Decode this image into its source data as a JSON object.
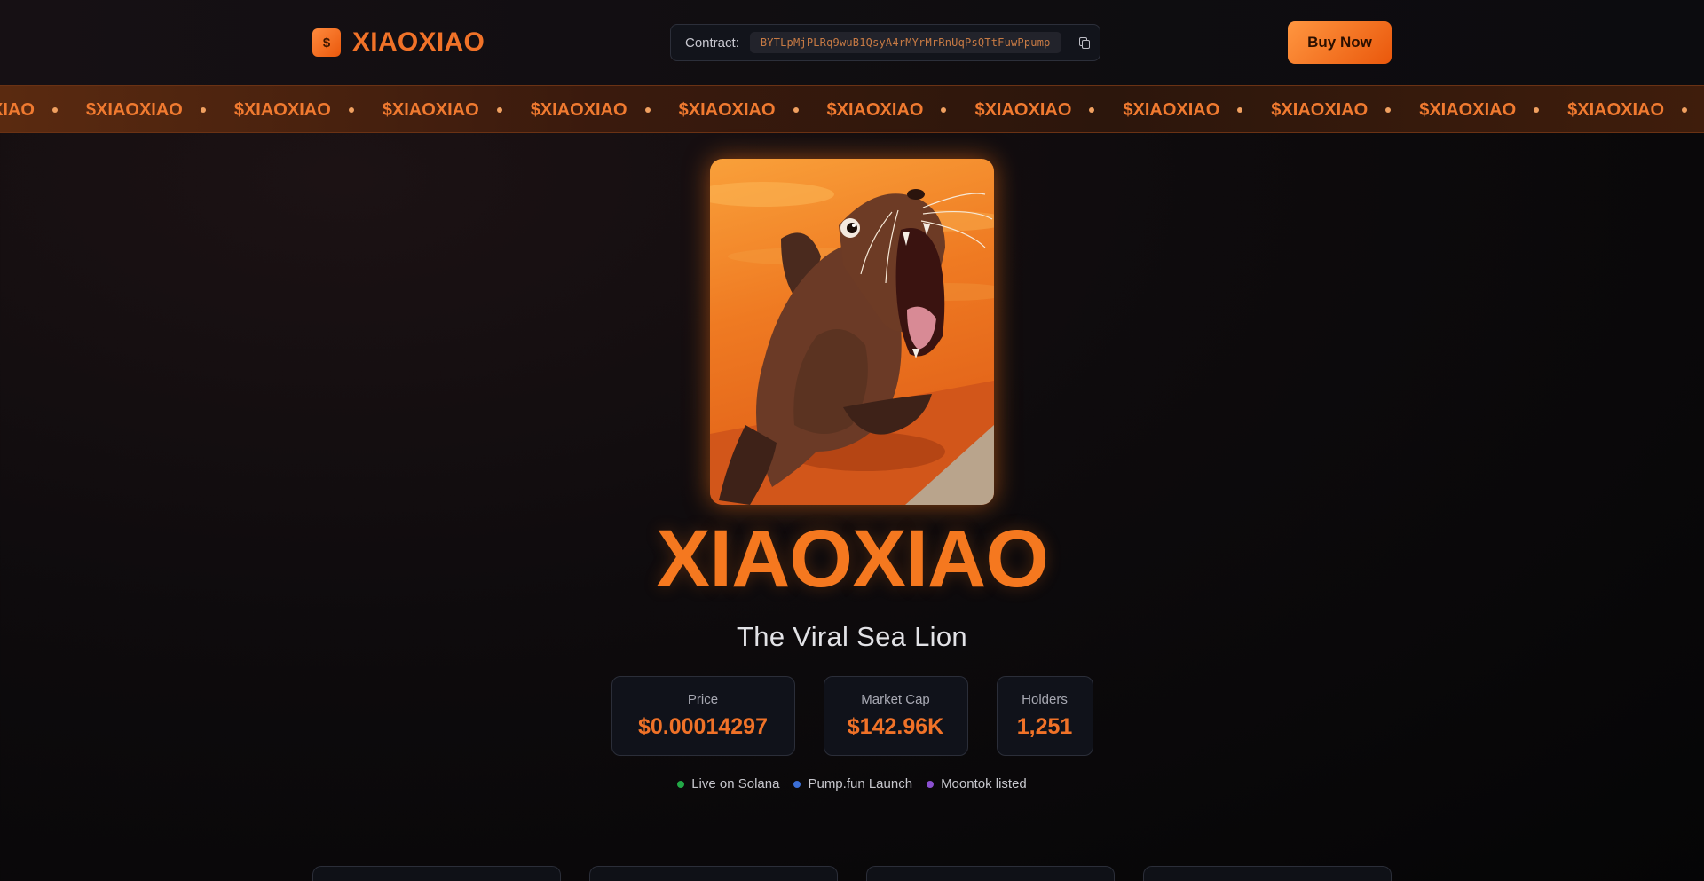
{
  "header": {
    "logo_symbol": "$",
    "logo_text": "XIAOXIAO",
    "contract_label": "Contract:",
    "contract_address": "BYTLpMjPLRq9wuB1QsyA4rMYrMrRnUqPsQTtFuwPpump",
    "buy_label": "Buy Now"
  },
  "marquee": {
    "items": [
      "$XIAOXIAO",
      "$XIAOXIAO",
      "$XIAOXIAO",
      "$XIAOXIAO",
      "$XIAOXIAO",
      "$XIAOXIAO",
      "$XIAOXIAO",
      "$XIAOXIAO",
      "$XIAOXIAO",
      "$XIAOXIAO",
      "$XIAOXIAO",
      "$XIAOXIAO"
    ]
  },
  "hero": {
    "title": "XIAOXIAO",
    "subtitle": "The Viral Sea Lion"
  },
  "stats": [
    {
      "label": "Price",
      "value": "$0.00014297"
    },
    {
      "label": "Market Cap",
      "value": "$142.96K"
    },
    {
      "label": "Holders",
      "value": "1,251"
    }
  ],
  "tags": [
    {
      "label": "Live on Solana",
      "color": "#22a846"
    },
    {
      "label": "Pump.fun Launch",
      "color": "#3b6fd6"
    },
    {
      "label": "Moontok listed",
      "color": "#8a4fd0"
    }
  ],
  "theme": {
    "accent": "#f07228",
    "accent_light": "#ff9640",
    "background": "#0e0b0d"
  }
}
